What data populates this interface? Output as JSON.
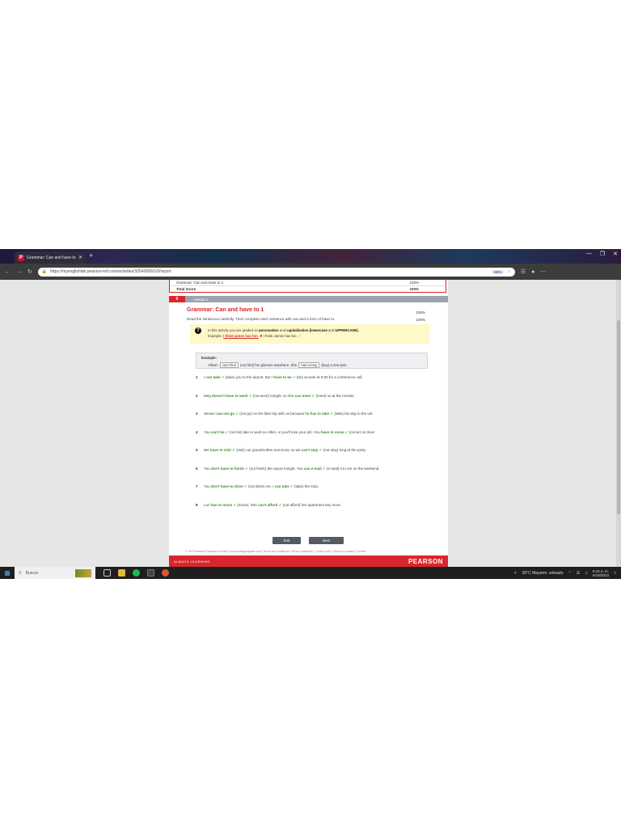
{
  "browser": {
    "tab_title": "Grammar: Can and have to 1 - ...",
    "tab_close": "✕",
    "new_tab": "+",
    "favicon_letter": "P",
    "window_controls": [
      "—",
      "❐",
      "✕"
    ],
    "url": "https://myenglishlab.pearson-intl.com/activities/10542006/1/0/report",
    "zoom": "80%"
  },
  "scores": [
    {
      "label": "Grammar: Can and have to 1",
      "value": "100%"
    },
    {
      "label": "Total Score",
      "value": "100%"
    }
  ],
  "lesson": {
    "number": "6",
    "label": "Lesson 1"
  },
  "exercise": {
    "title": "Grammar: Can and have to 1",
    "percent_top": "100%",
    "instructions": "Read the sentences carefully. Then complete each sentence with can and a form of have to.",
    "percent_instr": "100%"
  },
  "hint": {
    "line1_pre": "In this activity you are graded on ",
    "line1_bold1": "punctuation",
    "line1_mid": " and ",
    "line1_bold2": "capitalization (lowercase",
    "line1_mid2": " and ",
    "line1_bold3": "UPPERCASE).",
    "line2_pre": "Example: ",
    "wrong": "I think james has fun.",
    "cross": "✖",
    "right": "I think James has fun.",
    "check": "✓"
  },
  "example": {
    "heading": "Example:",
    "pre": "Allison ",
    "box1": "can't find",
    "mid": " (not find) her glasses anywhere. She ",
    "box2": "has to buy",
    "post": " (buy) a new pair."
  },
  "items": [
    {
      "n": "1",
      "parts": [
        {
          "t": "I "
        },
        {
          "a": "can take ✓"
        },
        {
          "t": " (take) you to the airport. But I "
        },
        {
          "a": "have to be ✓"
        },
        {
          "t": " (be) at work at 8:00 for a conference call."
        }
      ]
    },
    {
      "n": "2",
      "parts": [
        {
          "t": "Meg "
        },
        {
          "a": "doesn't have to work ✓"
        },
        {
          "t": " (not work) tonight, so she "
        },
        {
          "a": "can meet ✓"
        },
        {
          "t": " (meet) us at the movies."
        }
      ]
    },
    {
      "n": "3",
      "parts": [
        {
          "t": "Steven "
        },
        {
          "a": "can not go ✓"
        },
        {
          "t": " (not go) on the bike trip with us because he "
        },
        {
          "a": "has to take ✓"
        },
        {
          "t": " (take) his dog to the vet."
        }
      ]
    },
    {
      "n": "4",
      "parts": [
        {
          "t": "You "
        },
        {
          "a": "can't be ✓"
        },
        {
          "t": " (not be) late to work so often, or you'll lose your job. You "
        },
        {
          "a": "have to come ✓"
        },
        {
          "t": " (come) on time!"
        }
      ]
    },
    {
      "n": "5",
      "parts": [
        {
          "t": "We "
        },
        {
          "a": "have to visit ✓"
        },
        {
          "t": " (visit) our grandmother tomorrow, so we "
        },
        {
          "a": "can't stay ✓"
        },
        {
          "t": " (not stay) long at the party."
        }
      ]
    },
    {
      "n": "6",
      "parts": [
        {
          "t": "You "
        },
        {
          "a": "don't have to finish ✓"
        },
        {
          "t": " (not finish) the report tonight. You "
        },
        {
          "a": "can e-mail ✓"
        },
        {
          "t": " (e-mail) it to me on the weekend."
        }
      ]
    },
    {
      "n": "7",
      "parts": [
        {
          "t": "You "
        },
        {
          "a": "don't have to drive ✓"
        },
        {
          "t": " (not drive) me. I "
        },
        {
          "a": "can take ✓"
        },
        {
          "t": " (take) the train."
        }
      ]
    },
    {
      "n": "8",
      "parts": [
        {
          "t": "Lori "
        },
        {
          "a": "has to move ✓"
        },
        {
          "t": " (move). She "
        },
        {
          "a": "can't afford ✓"
        },
        {
          "t": " (not afford) her apartment any more."
        }
      ]
    }
  ],
  "buttons": {
    "exit": "Exit",
    "next": "Next"
  },
  "footer": "© 2023 Pearson Education Limited | www.mylanguagelab.com | Terms and conditions | Privacy statement | Cookie policy | Report a problem | Credits",
  "brand": {
    "tagline": "ALWAYS LEARNING",
    "logo": "PEARSON"
  },
  "taskbar": {
    "search_placeholder": "Buscar",
    "weather": "26°C  Mayorm. soleado",
    "time": "9:15 a. m.",
    "date": "6/18/2023"
  },
  "colors": {
    "accent": "#d9262d",
    "correct": "#3d8b2a",
    "hint_bg": "#fff8c8"
  }
}
